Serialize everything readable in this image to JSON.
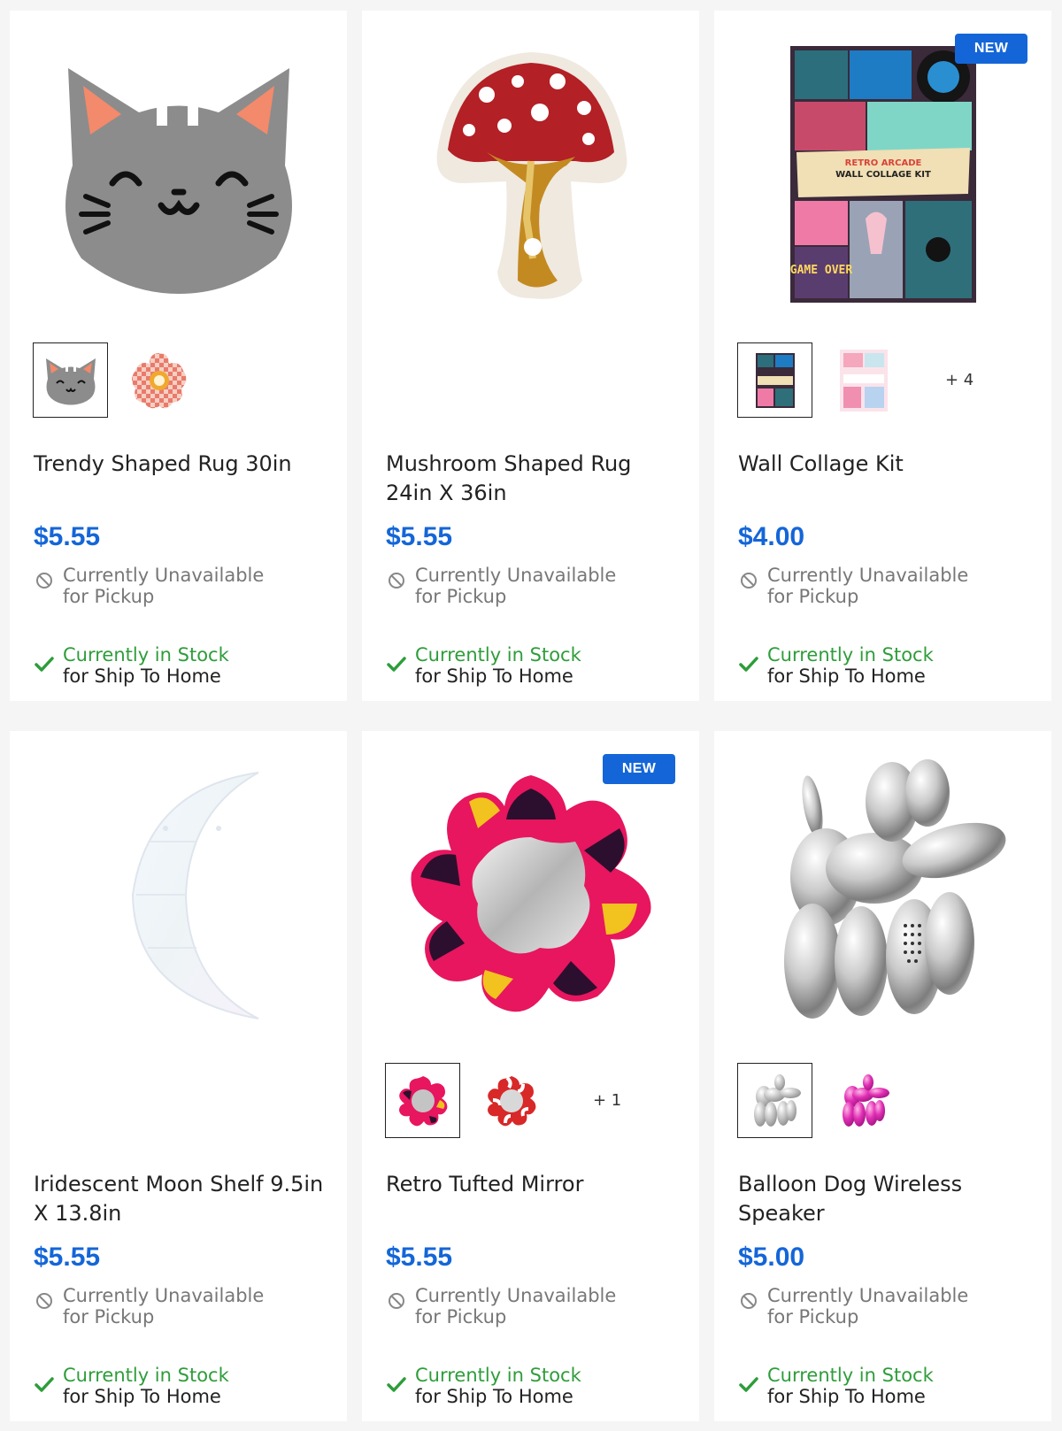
{
  "products": [
    {
      "title": "Trendy Shaped Rug 30in",
      "price": "$5.55",
      "badge": "",
      "swatches": [
        "cat-rug",
        "checker-flower-rug"
      ],
      "more": "",
      "pickup_line1": "Currently Unavailable",
      "pickup_line2": "for Pickup",
      "ship_line1": "Currently in Stock",
      "ship_line2": "for Ship To Home"
    },
    {
      "title": "Mushroom Shaped Rug 24in X 36in",
      "price": "$5.55",
      "badge": "",
      "swatches": [],
      "more": "",
      "pickup_line1": "Currently Unavailable",
      "pickup_line2": "for Pickup",
      "ship_line1": "Currently in Stock",
      "ship_line2": "for Ship To Home"
    },
    {
      "title": "Wall Collage Kit",
      "price": "$4.00",
      "badge": "NEW",
      "swatches": [
        "retro-arcade-kit",
        "pink-collage-kit"
      ],
      "more": "+ 4",
      "pickup_line1": "Currently Unavailable",
      "pickup_line2": "for Pickup",
      "ship_line1": "Currently in Stock",
      "ship_line2": "for Ship To Home",
      "image_lettering": [
        "RETRO ARCADE",
        "WALL COLLAGE KIT",
        "GAME OVER"
      ]
    },
    {
      "title": "Iridescent Moon Shelf 9.5in X 13.8in",
      "price": "$5.55",
      "badge": "",
      "swatches": [],
      "more": "",
      "pickup_line1": "Currently Unavailable",
      "pickup_line2": "for Pickup",
      "ship_line1": "Currently in Stock",
      "ship_line2": "for Ship To Home"
    },
    {
      "title": "Retro Tufted Mirror",
      "price": "$5.55",
      "badge": "NEW",
      "swatches": [
        "multicolor-mirror",
        "red-white-mirror"
      ],
      "more": "+ 1",
      "pickup_line1": "Currently Unavailable",
      "pickup_line2": "for Pickup",
      "ship_line1": "Currently in Stock",
      "ship_line2": "for Ship To Home"
    },
    {
      "title": "Balloon Dog Wireless Speaker",
      "price": "$5.00",
      "badge": "",
      "swatches": [
        "silver-dog",
        "pink-dog"
      ],
      "more": "",
      "pickup_line1": "Currently Unavailable",
      "pickup_line2": "for Pickup",
      "ship_line1": "Currently in Stock",
      "ship_line2": "for Ship To Home"
    }
  ],
  "colors": {
    "price_blue": "#1466d8",
    "badge_blue": "#1466d8",
    "stock_green": "#2e9d3a",
    "unavailable_gray": "#777777"
  },
  "icons": {
    "pickup": "unavailable-circle-slash-icon",
    "ship": "checkmark-icon"
  }
}
